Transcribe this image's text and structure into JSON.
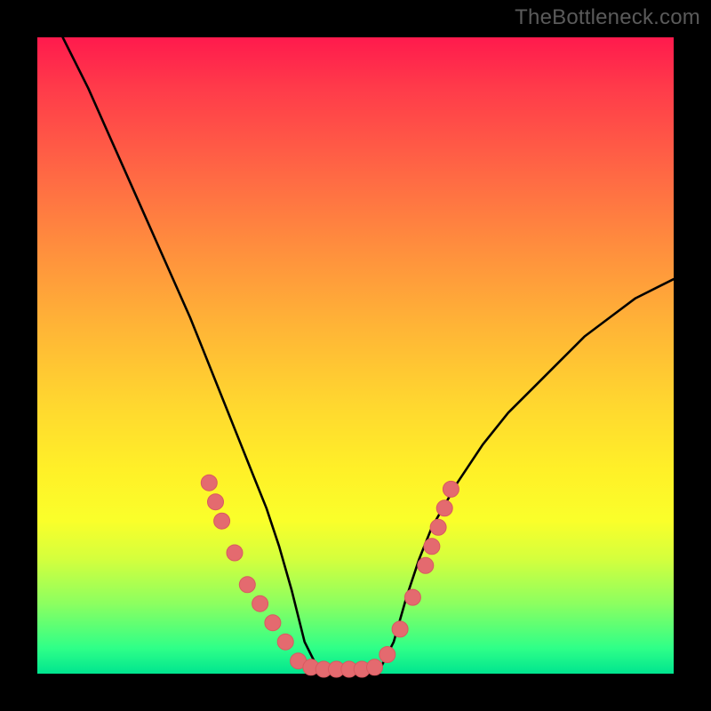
{
  "watermark": "TheBottleneck.com",
  "colors": {
    "background": "#000000",
    "curve": "#000000",
    "marker_fill": "#e46a6f",
    "marker_stroke": "#d85a60"
  },
  "chart_data": {
    "type": "line",
    "title": "",
    "xlabel": "",
    "ylabel": "",
    "xlim": [
      0,
      100
    ],
    "ylim": [
      0,
      100
    ],
    "grid": false,
    "legend": false,
    "note": "V-shaped bottleneck curve; minimum along bottom band ~x 41–54. Values estimated from pixel position (no axis ticks present).",
    "series": [
      {
        "name": "curve",
        "x": [
          4,
          8,
          12,
          16,
          20,
          24,
          26,
          28,
          30,
          32,
          34,
          36,
          38,
          40,
          42,
          44,
          46,
          48,
          50,
          52,
          54,
          56,
          58,
          60,
          62,
          66,
          70,
          74,
          78,
          82,
          86,
          90,
          94,
          98,
          100
        ],
        "y": [
          100,
          92,
          83,
          74,
          65,
          56,
          51,
          46,
          41,
          36,
          31,
          26,
          20,
          13,
          5,
          1,
          0.5,
          0.5,
          0.5,
          0.5,
          1,
          5,
          12,
          18,
          23,
          30,
          36,
          41,
          45,
          49,
          53,
          56,
          59,
          61,
          62
        ]
      }
    ],
    "markers": [
      {
        "x": 27,
        "y": 30
      },
      {
        "x": 28,
        "y": 27
      },
      {
        "x": 29,
        "y": 24
      },
      {
        "x": 31,
        "y": 19
      },
      {
        "x": 33,
        "y": 14
      },
      {
        "x": 35,
        "y": 11
      },
      {
        "x": 37,
        "y": 8
      },
      {
        "x": 39,
        "y": 5
      },
      {
        "x": 41,
        "y": 2
      },
      {
        "x": 43,
        "y": 1
      },
      {
        "x": 45,
        "y": 0.7
      },
      {
        "x": 47,
        "y": 0.7
      },
      {
        "x": 49,
        "y": 0.7
      },
      {
        "x": 51,
        "y": 0.7
      },
      {
        "x": 53,
        "y": 1
      },
      {
        "x": 55,
        "y": 3
      },
      {
        "x": 57,
        "y": 7
      },
      {
        "x": 59,
        "y": 12
      },
      {
        "x": 61,
        "y": 17
      },
      {
        "x": 62,
        "y": 20
      },
      {
        "x": 63,
        "y": 23
      },
      {
        "x": 64,
        "y": 26
      },
      {
        "x": 65,
        "y": 29
      }
    ]
  }
}
